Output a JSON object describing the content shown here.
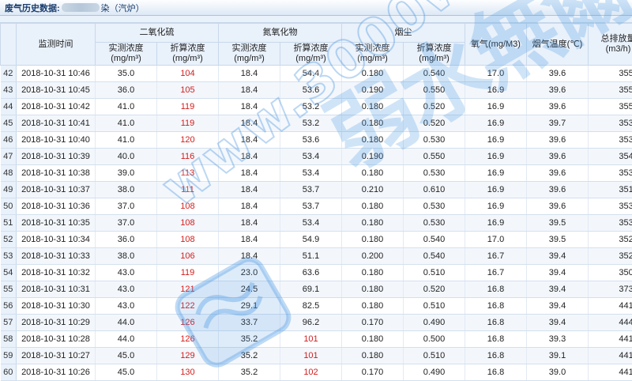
{
  "window": {
    "title_prefix": "废气历史数据:",
    "title_suffix": "染（汽炉）"
  },
  "table": {
    "header_time": "监测时间",
    "groups": [
      {
        "name": "二氧化硫",
        "sub": [
          "实测浓度",
          "折算浓度"
        ]
      },
      {
        "name": "氮氧化物",
        "sub": [
          "实测浓度",
          "折算浓度"
        ]
      },
      {
        "name": "烟尘",
        "sub": [
          "实测浓度",
          "折算浓度"
        ]
      }
    ],
    "unit": "(mg/m³)",
    "header_oxygen": "氧气(mg/M3)",
    "header_temp": "烟气温度(℃)",
    "header_flow": "总排放量(m3/h)",
    "rows": [
      {
        "n": "42",
        "time": "2018-10-31 10:46",
        "so2_m": "35.0",
        "so2_c": "104",
        "nox_m": "18.4",
        "nox_c": "54.4",
        "dust_m": "0.180",
        "dust_c": "0.540",
        "o2": "17.0",
        "temp": "39.6",
        "flow": "35520"
      },
      {
        "n": "43",
        "time": "2018-10-31 10:45",
        "so2_m": "36.0",
        "so2_c": "105",
        "nox_m": "18.4",
        "nox_c": "53.6",
        "dust_m": "0.190",
        "dust_c": "0.550",
        "o2": "16.9",
        "temp": "39.6",
        "flow": "35518"
      },
      {
        "n": "44",
        "time": "2018-10-31 10:42",
        "so2_m": "41.0",
        "so2_c": "119",
        "nox_m": "18.4",
        "nox_c": "53.2",
        "dust_m": "0.180",
        "dust_c": "0.520",
        "o2": "16.9",
        "temp": "39.6",
        "flow": "35510"
      },
      {
        "n": "45",
        "time": "2018-10-31 10:41",
        "so2_m": "41.0",
        "so2_c": "119",
        "nox_m": "18.4",
        "nox_c": "53.2",
        "dust_m": "0.180",
        "dust_c": "0.520",
        "o2": "16.9",
        "temp": "39.7",
        "flow": "35382"
      },
      {
        "n": "46",
        "time": "2018-10-31 10:40",
        "so2_m": "41.0",
        "so2_c": "120",
        "nox_m": "18.4",
        "nox_c": "53.6",
        "dust_m": "0.180",
        "dust_c": "0.530",
        "o2": "16.9",
        "temp": "39.6",
        "flow": "35329"
      },
      {
        "n": "47",
        "time": "2018-10-31 10:39",
        "so2_m": "40.0",
        "so2_c": "116",
        "nox_m": "18.4",
        "nox_c": "53.4",
        "dust_m": "0.190",
        "dust_c": "0.550",
        "o2": "16.9",
        "temp": "39.6",
        "flow": "35459"
      },
      {
        "n": "48",
        "time": "2018-10-31 10:38",
        "so2_m": "39.0",
        "so2_c": "113",
        "nox_m": "18.4",
        "nox_c": "53.4",
        "dust_m": "0.180",
        "dust_c": "0.530",
        "o2": "16.9",
        "temp": "39.6",
        "flow": "35343"
      },
      {
        "n": "49",
        "time": "2018-10-31 10:37",
        "so2_m": "38.0",
        "so2_c": "111",
        "nox_m": "18.4",
        "nox_c": "53.7",
        "dust_m": "0.210",
        "dust_c": "0.610",
        "o2": "16.9",
        "temp": "39.6",
        "flow": "35102"
      },
      {
        "n": "50",
        "time": "2018-10-31 10:36",
        "so2_m": "37.0",
        "so2_c": "108",
        "nox_m": "18.4",
        "nox_c": "53.7",
        "dust_m": "0.180",
        "dust_c": "0.530",
        "o2": "16.9",
        "temp": "39.6",
        "flow": "35390"
      },
      {
        "n": "51",
        "time": "2018-10-31 10:35",
        "so2_m": "37.0",
        "so2_c": "108",
        "nox_m": "18.4",
        "nox_c": "53.4",
        "dust_m": "0.180",
        "dust_c": "0.530",
        "o2": "16.9",
        "temp": "39.5",
        "flow": "35360"
      },
      {
        "n": "52",
        "time": "2018-10-31 10:34",
        "so2_m": "36.0",
        "so2_c": "108",
        "nox_m": "18.4",
        "nox_c": "54.9",
        "dust_m": "0.180",
        "dust_c": "0.540",
        "o2": "17.0",
        "temp": "39.5",
        "flow": "35219"
      },
      {
        "n": "53",
        "time": "2018-10-31 10:33",
        "so2_m": "38.0",
        "so2_c": "106",
        "nox_m": "18.4",
        "nox_c": "51.1",
        "dust_m": "0.200",
        "dust_c": "0.540",
        "o2": "16.7",
        "temp": "39.4",
        "flow": "35255"
      },
      {
        "n": "54",
        "time": "2018-10-31 10:32",
        "so2_m": "43.0",
        "so2_c": "119",
        "nox_m": "23.0",
        "nox_c": "63.6",
        "dust_m": "0.180",
        "dust_c": "0.510",
        "o2": "16.7",
        "temp": "39.4",
        "flow": "35088"
      },
      {
        "n": "55",
        "time": "2018-10-31 10:31",
        "so2_m": "43.0",
        "so2_c": "121",
        "nox_m": "24.5",
        "nox_c": "69.1",
        "dust_m": "0.180",
        "dust_c": "0.520",
        "o2": "16.8",
        "temp": "39.4",
        "flow": "37312"
      },
      {
        "n": "56",
        "time": "2018-10-31 10:30",
        "so2_m": "43.0",
        "so2_c": "122",
        "nox_m": "29.1",
        "nox_c": "82.5",
        "dust_m": "0.180",
        "dust_c": "0.510",
        "o2": "16.8",
        "temp": "39.4",
        "flow": "44191"
      },
      {
        "n": "57",
        "time": "2018-10-31 10:29",
        "so2_m": "44.0",
        "so2_c": "126",
        "nox_m": "33.7",
        "nox_c": "96.2",
        "dust_m": "0.170",
        "dust_c": "0.490",
        "o2": "16.8",
        "temp": "39.4",
        "flow": "44472"
      },
      {
        "n": "58",
        "time": "2018-10-31 10:28",
        "so2_m": "44.0",
        "so2_c": "126",
        "nox_m": "35.2",
        "nox_c": "101",
        "dust_m": "0.180",
        "dust_c": "0.500",
        "o2": "16.8",
        "temp": "39.3",
        "flow": "44147"
      },
      {
        "n": "59",
        "time": "2018-10-31 10:27",
        "so2_m": "45.0",
        "so2_c": "129",
        "nox_m": "35.2",
        "nox_c": "101",
        "dust_m": "0.180",
        "dust_c": "0.510",
        "o2": "16.8",
        "temp": "39.1",
        "flow": "44150"
      },
      {
        "n": "60",
        "time": "2018-10-31 10:26",
        "so2_m": "45.0",
        "so2_c": "130",
        "nox_m": "35.2",
        "nox_c": "102",
        "dust_m": "0.170",
        "dust_c": "0.490",
        "o2": "16.8",
        "temp": "39.0",
        "flow": "44191"
      }
    ]
  },
  "watermark": {
    "text": "www.3000water.com",
    "cn": "弱水無爾",
    "logo_text": "ENDLESS FLOW",
    "color": "#4696e1"
  }
}
